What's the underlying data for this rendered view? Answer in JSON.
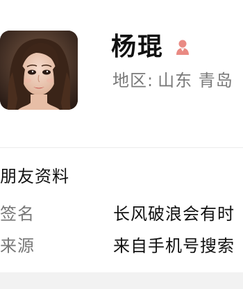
{
  "profile": {
    "name": "杨琨",
    "gender_icon": "female-user-icon",
    "region_label": "地区:",
    "region_value": "山东 青岛"
  },
  "friend_info": {
    "title": "朋友资料",
    "rows": [
      {
        "label": "签名",
        "value": "长风破浪会有时"
      },
      {
        "label": "来源",
        "value": "来自手机号搜索"
      }
    ]
  },
  "colors": {
    "gender_icon": "#e98a83",
    "secondary_text": "#7a7a7a",
    "background": "#ffffff",
    "band": "#f2f2f2"
  }
}
